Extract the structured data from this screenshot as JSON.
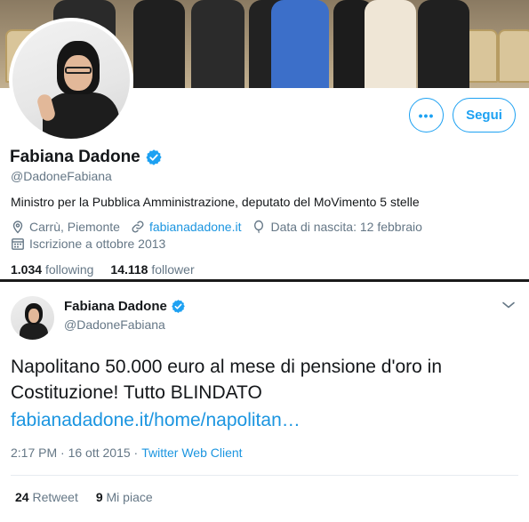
{
  "profile": {
    "name": "Fabiana Dadone",
    "handle": "@DadoneFabiana",
    "bio": "Ministro per la Pubblica Amministrazione, deputato del MoVimento 5 stelle",
    "location": "Carrù, Piemonte",
    "website": "fabianadadone.it",
    "birthdate": "Data di nascita: 12 febbraio",
    "joined": "Iscrizione a ottobre 2013",
    "following_count": "1.034",
    "following_label": "following",
    "followers_count": "14.118",
    "followers_label": "follower",
    "more_label": "•••",
    "follow_label": "Segui"
  },
  "tweet": {
    "name": "Fabiana Dadone",
    "handle": "@DadoneFabiana",
    "text": "Napolitano 50.000 euro al mese di pensione d'oro in Costituzione! Tutto BLINDATO",
    "link": "fabianadadone.it/home/napolitan…",
    "time": "2:17 PM · 16 ott 2015 ·",
    "client": "Twitter Web Client",
    "retweets_count": "24",
    "retweets_label": "Retweet",
    "likes_count": "9",
    "likes_label": "Mi piace"
  },
  "icons": {
    "verified": "verified-badge-icon",
    "location": "location-pin-icon",
    "link": "link-icon",
    "birthday": "balloon-icon",
    "calendar": "calendar-icon",
    "caret": "chevron-down-icon"
  },
  "colors": {
    "accent": "#1da1f2",
    "link": "#1b95e0",
    "secondary_text": "#657786",
    "primary_text": "#14171a"
  }
}
